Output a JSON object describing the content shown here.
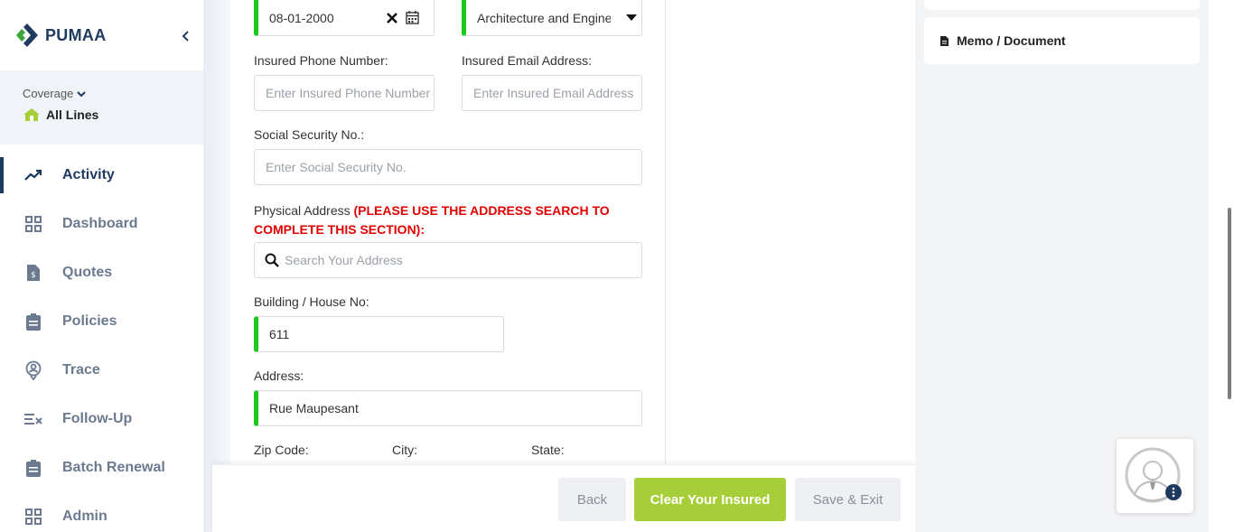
{
  "app": {
    "name": "PUMAA"
  },
  "coverage": {
    "label": "Coverage",
    "value": "All Lines"
  },
  "nav": {
    "items": [
      {
        "label": "Activity"
      },
      {
        "label": "Dashboard"
      },
      {
        "label": "Quotes"
      },
      {
        "label": "Policies"
      },
      {
        "label": "Trace"
      },
      {
        "label": "Follow-Up"
      },
      {
        "label": "Batch Renewal"
      },
      {
        "label": "Admin"
      }
    ]
  },
  "form": {
    "date_value": "08-01-2000",
    "industry_value": "Architecture and Engineering",
    "phone": {
      "label": "Insured Phone Number:",
      "placeholder": "Enter Insured Phone Number"
    },
    "email": {
      "label": "Insured Email Address:",
      "placeholder": "Enter Insured Email Address"
    },
    "ssn": {
      "label": "Social Security No.:",
      "placeholder": "Enter Social Security No."
    },
    "physical_address": {
      "label": "Physical Address ",
      "warning_line1": "(PLEASE USE THE ADDRESS SEARCH TO",
      "warning_line2": "COMPLETE THIS SECTION):",
      "search_placeholder": "Search Your Address"
    },
    "building": {
      "label": "Building / House No:",
      "value": "611"
    },
    "address": {
      "label": "Address:",
      "value": "Rue Maupesant"
    },
    "zip": {
      "label": "Zip Code:"
    },
    "city": {
      "label": "City:"
    },
    "state": {
      "label": "State:"
    }
  },
  "footer": {
    "back": "Back",
    "clear": "Clear Your Insured",
    "save_exit": "Save & Exit"
  },
  "right_panel": {
    "memo_label": "Memo / Document"
  },
  "colors": {
    "brand": "#1f3a5f",
    "accent_green": "#a6ce39",
    "valid_bar": "#1ec71e",
    "warning": "#e00000"
  }
}
